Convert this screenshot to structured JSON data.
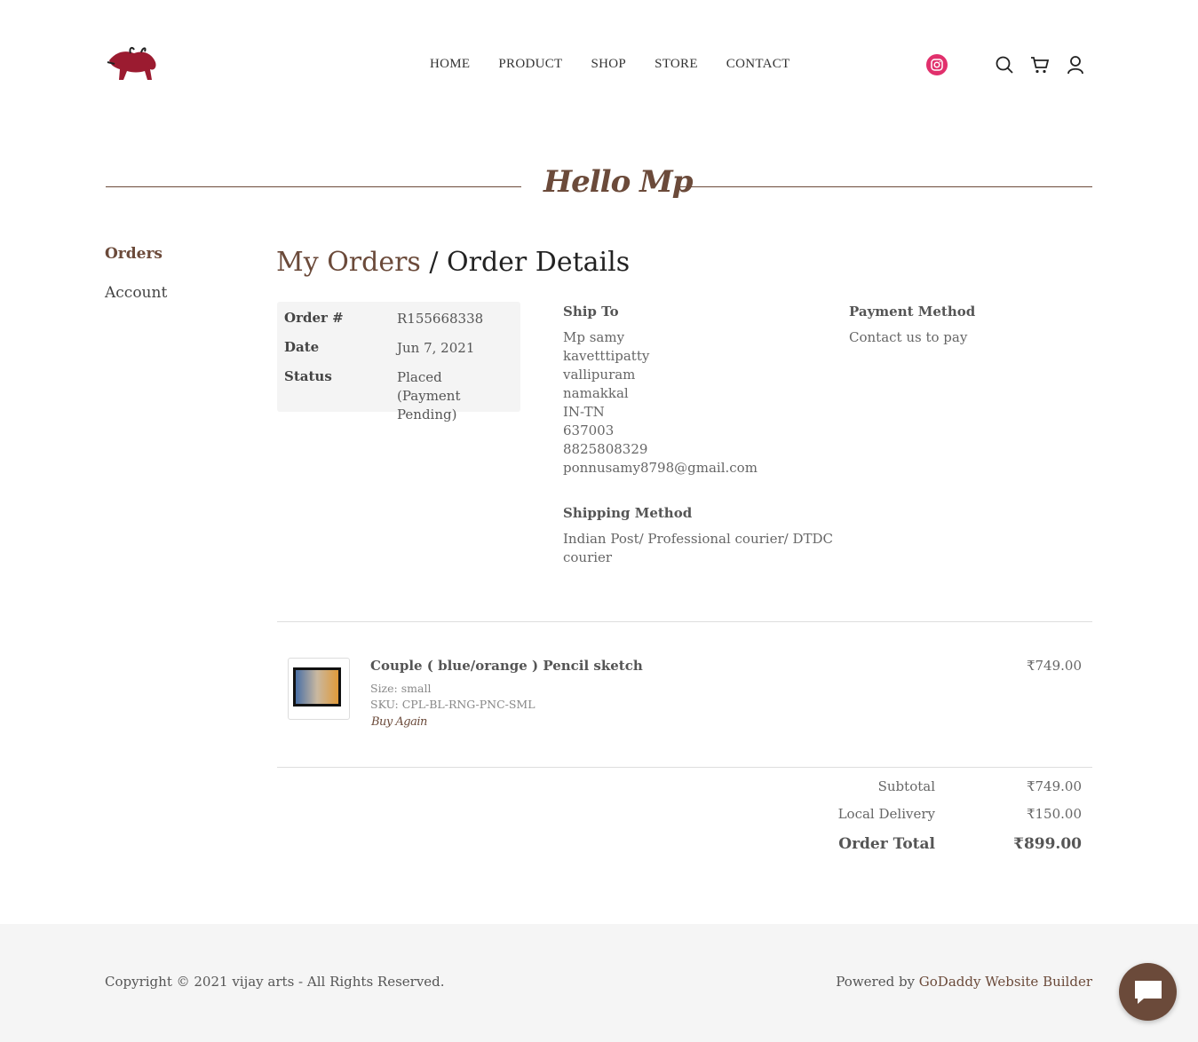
{
  "header": {
    "nav": [
      "HOME",
      "PRODUCT",
      "SHOP",
      "STORE",
      "CONTACT"
    ],
    "social_icon": "instagram-icon",
    "icons": [
      "search-icon",
      "cart-icon",
      "user-icon"
    ]
  },
  "greeting": "Hello Mp",
  "sidebar": {
    "items": [
      {
        "label": "Orders",
        "active": true
      },
      {
        "label": "Account",
        "active": false
      }
    ]
  },
  "page": {
    "breadcrumb": "My Orders",
    "separator": " / ",
    "title": "Order Details"
  },
  "order": {
    "number_label": "Order #",
    "number": "R155668338",
    "date_label": "Date",
    "date": "Jun 7, 2021",
    "status_label": "Status",
    "status": "Placed",
    "status_note": "(Payment Pending)"
  },
  "ship_to": {
    "heading": "Ship To",
    "lines": [
      "Mp samy",
      "kavetttipatty",
      "vallipuram",
      "namakkal",
      "IN-TN",
      "637003",
      "8825808329",
      "ponnusamy8798@gmail.com"
    ]
  },
  "payment": {
    "heading": "Payment Method",
    "value": "Contact us to pay"
  },
  "shipping": {
    "heading": "Shipping Method",
    "line1": "Indian Post/ Professional courier/ DTDC",
    "line2": "courier"
  },
  "item": {
    "name": "Couple ( blue/orange ) Pencil sketch",
    "size": "Size: small",
    "sku": "SKU: CPL-BL-RNG-PNC-SML",
    "buy_again": "Buy Again",
    "price": "₹749.00"
  },
  "totals": {
    "subtotal_label": "Subtotal",
    "subtotal": "₹749.00",
    "delivery_label": "Local Delivery",
    "delivery": "₹150.00",
    "total_label": "Order Total",
    "total": "₹899.00"
  },
  "footer": {
    "copyright": "Copyright © 2021 vijay arts - All Rights Reserved.",
    "powered_prefix": "Powered by ",
    "powered_link": "GoDaddy Website Builder",
    "chat_icon": "chat-icon"
  },
  "colors": {
    "accent": "#6b4a3a",
    "instagram": "#e1306c",
    "footer_bg": "#f5f5f5"
  }
}
